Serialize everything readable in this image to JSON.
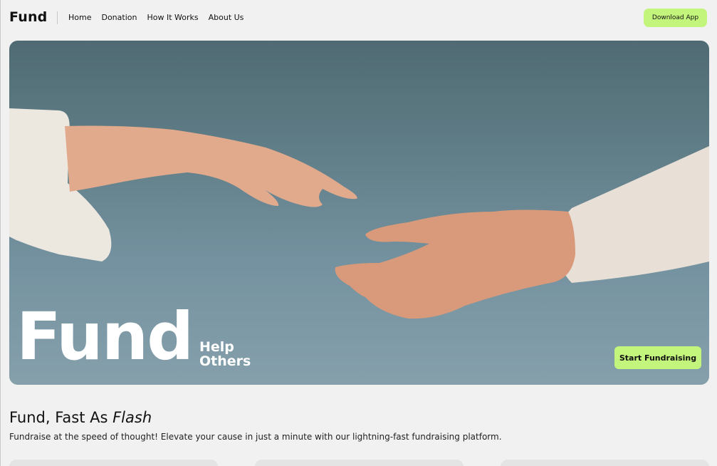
{
  "nav": {
    "brand": "Fund",
    "links": [
      "Home",
      "Donation",
      "How It Works",
      "About Us"
    ],
    "download_label": "Download App"
  },
  "hero": {
    "title": "Fund",
    "subtitle_line1": "Help",
    "subtitle_line2": "Others",
    "cta_label": "Start Fundraising"
  },
  "section": {
    "title_prefix": "Fund, Fast As ",
    "title_emphasis": "Flash",
    "description": "Fundraise at the speed of thought! Elevate your cause in just a minute with our lightning-fast fundraising platform."
  },
  "colors": {
    "accent": "#c3f57c",
    "background": "#f1f1f1"
  }
}
